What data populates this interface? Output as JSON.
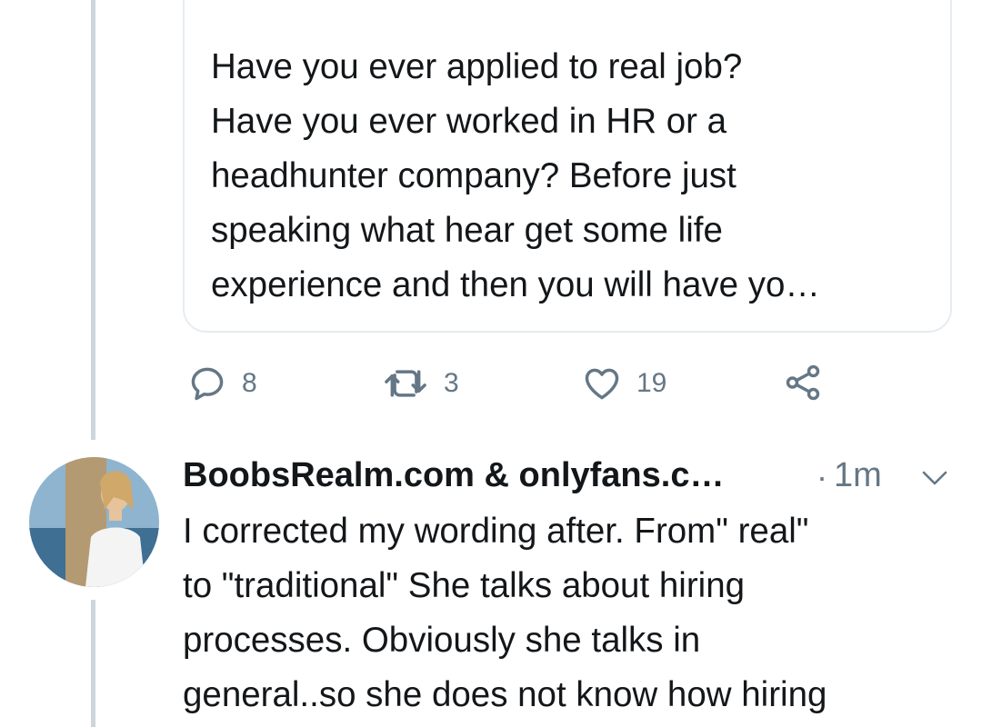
{
  "quoted_tweet": {
    "text": "Have you ever applied to real job?\nHave you ever worked in HR or a\nheadhunter company? Before just\nspeaking what hear get some life\nexperience and then you will have yo…"
  },
  "actions": {
    "reply": {
      "icon": "reply-icon",
      "count": "8"
    },
    "retweet": {
      "icon": "retweet-icon",
      "count": "3"
    },
    "like": {
      "icon": "heart-icon",
      "count": "19"
    },
    "share": {
      "icon": "share-icon"
    }
  },
  "reply_tweet": {
    "author_name": "BoobsRealm.com & onlyfans.c…",
    "separator": "·",
    "time": "1m",
    "text": "I corrected my wording after. From\" real\"\nto \"traditional\" She talks about hiring\nprocesses. Obviously she talks in\ngeneral..so she does not know how hiring"
  },
  "colors": {
    "text": "#14171a",
    "secondary": "#657786",
    "thread_line": "#ccd6dd",
    "border": "#e6ecf0"
  }
}
